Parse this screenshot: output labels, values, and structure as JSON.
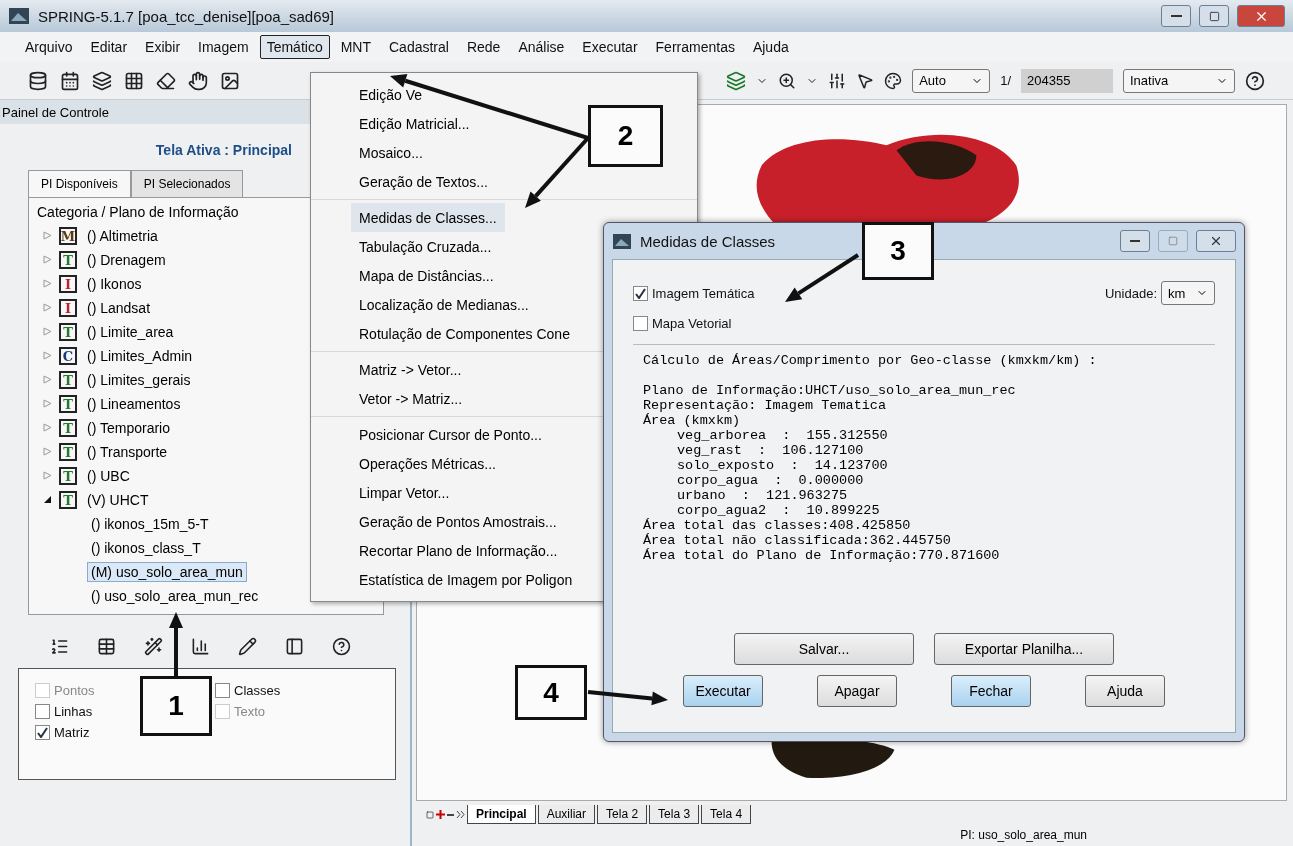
{
  "window": {
    "title": "SPRING-5.1.7 [poa_tcc_denise][poa_sad69]"
  },
  "menu_bar": [
    {
      "label": "Arquivo",
      "selected": false
    },
    {
      "label": "Editar",
      "selected": false
    },
    {
      "label": "Exibir",
      "selected": false
    },
    {
      "label": "Imagem",
      "selected": false
    },
    {
      "label": "Temático",
      "selected": true
    },
    {
      "label": "MNT",
      "selected": false
    },
    {
      "label": "Cadastral",
      "selected": false
    },
    {
      "label": "Rede",
      "selected": false
    },
    {
      "label": "Análise",
      "selected": false
    },
    {
      "label": "Executar",
      "selected": false
    },
    {
      "label": "Ferramentas",
      "selected": false
    },
    {
      "label": "Ajuda",
      "selected": false
    }
  ],
  "toolbar": {
    "scale_mode": "Auto",
    "scale_prefix": "1/",
    "scale_value": "204355",
    "cursor_mode": "Inativa"
  },
  "control_panel": {
    "title": "Painel de Controle",
    "active_screen": "Tela Ativa : Principal",
    "tabs": [
      {
        "label": "PI Disponíveis",
        "selected": true
      },
      {
        "label": "PI Selecionados",
        "selected": false
      }
    ],
    "tree_header": "Categoria / Plano de Informação",
    "tree": [
      {
        "badge": "M",
        "color": "#5a3a10",
        "label": "() Altimetria",
        "expanded": false
      },
      {
        "badge": "T",
        "color": "#1f7a2a",
        "label": "() Drenagem",
        "expanded": false
      },
      {
        "badge": "I",
        "color": "#c0202a",
        "label": "() Ikonos",
        "expanded": false
      },
      {
        "badge": "I",
        "color": "#c0202a",
        "label": "() Landsat",
        "expanded": false
      },
      {
        "badge": "T",
        "color": "#1f7a2a",
        "label": "() Limite_area",
        "expanded": false
      },
      {
        "badge": "C",
        "color": "#1a3a7a",
        "label": "() Limites_Admin",
        "expanded": false
      },
      {
        "badge": "T",
        "color": "#1f7a2a",
        "label": "() Limites_gerais",
        "expanded": false
      },
      {
        "badge": "T",
        "color": "#1f7a2a",
        "label": "() Lineamentos",
        "expanded": false
      },
      {
        "badge": "T",
        "color": "#1f7a2a",
        "label": "() Temporario",
        "expanded": false
      },
      {
        "badge": "T",
        "color": "#1f7a2a",
        "label": "() Transporte",
        "expanded": false
      },
      {
        "badge": "T",
        "color": "#1f7a2a",
        "label": "() UBC",
        "expanded": false
      },
      {
        "badge": "T",
        "color": "#1f7a2a",
        "label": "(V) UHCT",
        "expanded": true,
        "children": [
          {
            "label": "() ikonos_15m_5-T",
            "selected": false
          },
          {
            "label": "() ikonos_class_T",
            "selected": false
          },
          {
            "label": "(M) uso_solo_area_mun",
            "selected": true
          },
          {
            "label": "() uso_solo_area_mun_rec",
            "selected": false
          }
        ]
      }
    ],
    "layers": [
      {
        "label": "Pontos",
        "checked": false,
        "disabled": true
      },
      {
        "label": "Classes",
        "checked": false,
        "disabled": false
      },
      {
        "label": "Linhas",
        "checked": false,
        "disabled": false
      },
      {
        "label": "Texto",
        "checked": false,
        "disabled": true
      },
      {
        "label": "Matriz",
        "checked": true,
        "disabled": false
      }
    ]
  },
  "thematic_menu": {
    "groups": [
      [
        {
          "label": "Edição Ve",
          "selected": false
        },
        {
          "label": "Edição Matricial...",
          "selected": false
        },
        {
          "label": "Mosaico...",
          "selected": false
        },
        {
          "label": "Geração de Textos...",
          "selected": false
        }
      ],
      [
        {
          "label": "Medidas de Classes...",
          "selected": true
        },
        {
          "label": "Tabulação Cruzada...",
          "selected": false
        },
        {
          "label": "Mapa de Distâncias...",
          "selected": false
        },
        {
          "label": "Localização de Medianas...",
          "selected": false
        },
        {
          "label": "Rotulação de Componentes Cone",
          "selected": false
        }
      ],
      [
        {
          "label": "Matriz -> Vetor...",
          "selected": false
        },
        {
          "label": "Vetor -> Matriz...",
          "selected": false
        }
      ],
      [
        {
          "label": "Posicionar Cursor de Ponto...",
          "selected": false
        },
        {
          "label": "Operações Métricas...",
          "selected": false
        },
        {
          "label": "Limpar Vetor...",
          "selected": false
        },
        {
          "label": "Geração de Pontos Amostrais...",
          "selected": false
        },
        {
          "label": "Recortar Plano de Informação...",
          "selected": false
        },
        {
          "label": "Estatística de Imagem por Poligon",
          "selected": false
        }
      ]
    ]
  },
  "dialog": {
    "title": "Medidas de Classes",
    "options": [
      {
        "label": "Imagem Temática",
        "checked": true
      },
      {
        "label": "Mapa Vetorial",
        "checked": false
      }
    ],
    "unit_label": "Unidade:",
    "unit_value": "km",
    "report_title": "Cálculo de Áreas/Comprimento por Geo-classe (kmxkm/km) :",
    "report_lines": [
      {
        "text": "Plano de Informação:UHCT/uso_solo_area_mun_rec",
        "indented": false
      },
      {
        "text": "Representação: Imagem Tematica",
        "indented": false
      },
      {
        "text": "Área (kmxkm)",
        "indented": false
      },
      {
        "text": "veg_arborea  :  155.312550",
        "indented": true
      },
      {
        "text": "veg_rast  :  106.127100",
        "indented": true
      },
      {
        "text": "solo_exposto  :  14.123700",
        "indented": true
      },
      {
        "text": "corpo_agua  :  0.000000",
        "indented": true
      },
      {
        "text": "urbano  :  121.963275",
        "indented": true
      },
      {
        "text": "corpo_agua2  :  10.899225",
        "indented": true
      },
      {
        "text": "Área total das classes:408.425850",
        "indented": false
      },
      {
        "text": "Área total não classificada:362.445750",
        "indented": false
      },
      {
        "text": "Área total do Plano de Informação:770.871600",
        "indented": false
      }
    ],
    "export_buttons": [
      {
        "label": "Salvar...",
        "highlighted": false
      },
      {
        "label": "Exportar Planilha...",
        "highlighted": false
      }
    ],
    "action_buttons": [
      {
        "label": "Executar",
        "highlighted": true
      },
      {
        "label": "Apagar",
        "highlighted": false
      },
      {
        "label": "Fechar",
        "highlighted": true
      },
      {
        "label": "Ajuda",
        "highlighted": false
      }
    ]
  },
  "screen_tabs": [
    {
      "label": "Principal",
      "selected": true
    },
    {
      "label": "Auxiliar",
      "selected": false
    },
    {
      "label": "Tela 2",
      "selected": false
    },
    {
      "label": "Tela 3",
      "selected": false
    },
    {
      "label": "Tela 4",
      "selected": false
    }
  ],
  "status": "PI: uso_solo_area_mun",
  "callouts": [
    "1",
    "2",
    "3",
    "4"
  ]
}
